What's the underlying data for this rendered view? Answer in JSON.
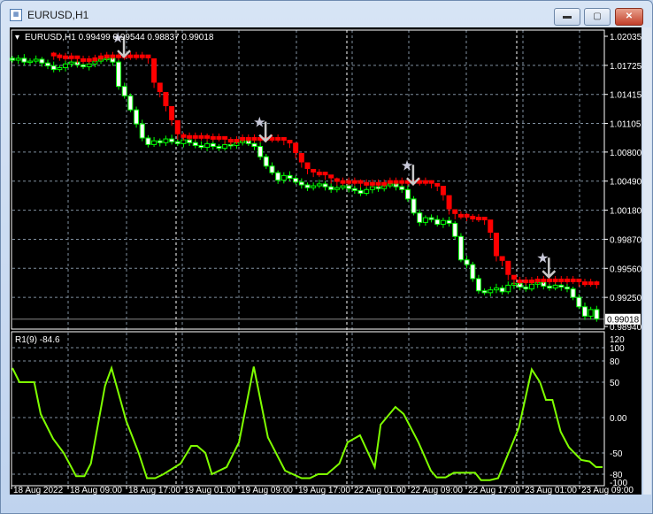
{
  "window": {
    "title": "EURUSD,H1",
    "minimize_label": "▬",
    "maximize_label": "▢",
    "close_label": "✕"
  },
  "main_panel": {
    "label": "EURUSD,H1  0.99499 0.99544 0.98837 0.99018",
    "current_price": "0.99018",
    "price_ticks": [
      "1.02035",
      "1.01725",
      "1.01415",
      "1.01105",
      "1.00800",
      "1.00490",
      "1.00180",
      "0.99870",
      "0.99560",
      "0.99250",
      "0.98940"
    ]
  },
  "indicator_panel": {
    "label": "R1(9) -84.6",
    "ticks": [
      "120",
      "100",
      "80",
      "50",
      "0.00",
      "-50",
      "-80",
      "-100"
    ]
  },
  "time_axis": [
    "18 Aug 2022",
    "18 Aug 09:00",
    "18 Aug 17:00",
    "19 Aug 01:00",
    "19 Aug 09:00",
    "19 Aug 17:00",
    "22 Aug 01:00",
    "22 Aug 09:00",
    "22 Aug 17:00",
    "23 Aug 01:00",
    "23 Aug 09:00"
  ],
  "colors": {
    "bull": "#00ff00",
    "bear_fill": "#ffffff",
    "trail": "#ff0000",
    "indicator": "#7fff00",
    "grid": "#8090a0"
  },
  "chart_data": {
    "type": "candlestick",
    "symbol": "EURUSD",
    "timeframe": "H1",
    "ylim": [
      0.9894,
      1.02035
    ],
    "closes": [
      1.0178,
      1.018,
      1.0176,
      1.0177,
      1.0179,
      1.0175,
      1.0172,
      1.0168,
      1.017,
      1.0174,
      1.0176,
      1.0173,
      1.0171,
      1.0174,
      1.0177,
      1.0179,
      1.018,
      1.0176,
      1.015,
      1.014,
      1.0125,
      1.011,
      1.0095,
      1.0088,
      1.0092,
      1.009,
      1.0094,
      1.0091,
      1.0089,
      1.0093,
      1.009,
      1.0087,
      1.0085,
      1.0089,
      1.0086,
      1.0084,
      1.0088,
      1.0087,
      1.009,
      1.0092,
      1.0089,
      1.0086,
      1.0075,
      1.0065,
      1.0058,
      1.005,
      1.0055,
      1.0052,
      1.0048,
      1.0045,
      1.0042,
      1.0044,
      1.0046,
      1.0043,
      1.004,
      1.0042,
      1.0044,
      1.0041,
      1.0039,
      1.0036,
      1.004,
      1.0043,
      1.0041,
      1.0044,
      1.0046,
      1.0043,
      1.004,
      1.003,
      1.0015,
      1.0005,
      1.001,
      1.0008,
      1.0003,
      1.0007,
      1.0004,
      0.999,
      0.9965,
      0.996,
      0.9945,
      0.9932,
      0.993,
      0.9933,
      0.9935,
      0.9931,
      0.9938,
      0.994,
      0.9936,
      0.9934,
      0.9939,
      0.9941,
      0.9937,
      0.9935,
      0.9938,
      0.9936,
      0.9934,
      0.9925,
      0.9915,
      0.9905,
      0.9912,
      0.9902
    ],
    "signal_bars": [
      18,
      42,
      67,
      90
    ],
    "indicator": {
      "name": "R1(9)",
      "ylim": [
        -100,
        120
      ],
      "points": [
        [
          0,
          70
        ],
        [
          1.2,
          50
        ],
        [
          3.7,
          50
        ],
        [
          4.8,
          5
        ],
        [
          6.9,
          -30
        ],
        [
          8.7,
          -50
        ],
        [
          10.8,
          -85
        ],
        [
          12.2,
          -85
        ],
        [
          13.3,
          -65
        ],
        [
          15.7,
          45
        ],
        [
          16.8,
          70
        ],
        [
          19.3,
          -5
        ],
        [
          21.4,
          -50
        ],
        [
          22.8,
          -90
        ],
        [
          24.2,
          -90
        ],
        [
          25.6,
          -80
        ],
        [
          28.5,
          -65
        ],
        [
          30.3,
          -40
        ],
        [
          31.3,
          -40
        ],
        [
          32.7,
          -50
        ],
        [
          33.8,
          -80
        ],
        [
          36.3,
          -70
        ],
        [
          38.4,
          -35
        ],
        [
          40.9,
          72
        ],
        [
          43.3,
          -28
        ],
        [
          46.2,
          -75
        ],
        [
          49,
          -90
        ],
        [
          50.4,
          -90
        ],
        [
          51.8,
          -80
        ],
        [
          53.3,
          -80
        ],
        [
          55.4,
          -65
        ],
        [
          56.8,
          -35
        ],
        [
          58.9,
          -25
        ],
        [
          61.4,
          -70
        ],
        [
          62.4,
          -10
        ],
        [
          64.9,
          15
        ],
        [
          66.3,
          5
        ],
        [
          68.8,
          -35
        ],
        [
          70.9,
          -75
        ],
        [
          71.9,
          -88
        ],
        [
          73.4,
          -88
        ],
        [
          74.8,
          -78
        ],
        [
          78.4,
          -78
        ],
        [
          79.4,
          -95
        ],
        [
          80.9,
          -95
        ],
        [
          82.3,
          -90
        ],
        [
          85.8,
          -15
        ],
        [
          88,
          68
        ],
        [
          89.4,
          50
        ],
        [
          90.4,
          25
        ],
        [
          91.5,
          25
        ],
        [
          92.9,
          -20
        ],
        [
          94.3,
          -42
        ],
        [
          96.4,
          -60
        ],
        [
          97.8,
          -62
        ],
        [
          98.9,
          -70
        ],
        [
          100,
          -70
        ]
      ]
    }
  }
}
